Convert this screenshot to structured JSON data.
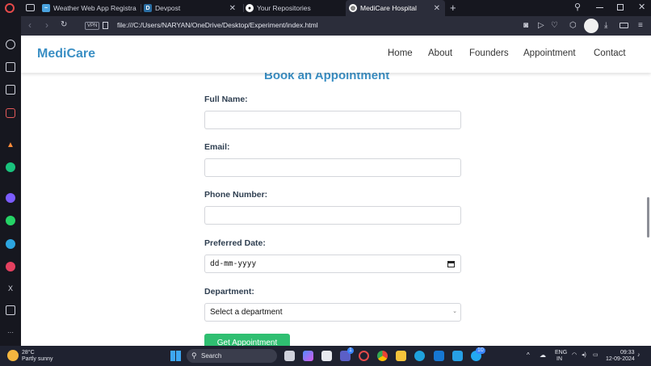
{
  "tabs": [
    {
      "title": "Weather Web App Registra",
      "favicon": "weather-icon"
    },
    {
      "title": "Devpost",
      "favicon": "devpost-icon"
    },
    {
      "title": "Your Repositories",
      "favicon": "github-icon"
    },
    {
      "title": "MediCare Hospital",
      "favicon": "globe-icon",
      "active": true
    }
  ],
  "address": {
    "vpn": "VPN",
    "url": "file:///C:/Users/NARYAN/OneDrive/Desktop/Experiment/index.html"
  },
  "site": {
    "brand": "MediCare",
    "nav": [
      "Home",
      "About",
      "Founders",
      "Appointment",
      "Contact"
    ],
    "heading": "Book an Appointment",
    "form": {
      "full_name_label": "Full Name:",
      "email_label": "Email:",
      "phone_label": "Phone Number:",
      "date_label": "Preferred Date:",
      "date_placeholder": "dd-mm-yyyy",
      "department_label": "Department:",
      "department_selected": "Select a department",
      "submit_label": "Get Appointment"
    }
  },
  "taskbar": {
    "weather_temp": "28°C",
    "weather_desc": "Partly sunny",
    "search_placeholder": "Search",
    "lang_top": "ENG",
    "lang_bottom": "IN",
    "time": "09:33",
    "date": "12-09-2024",
    "badge_a": "1",
    "badge_b": "10"
  },
  "colors": {
    "brand": "#3a8fc4",
    "submit": "#2fbf71",
    "browser_dark": "#16171f"
  }
}
